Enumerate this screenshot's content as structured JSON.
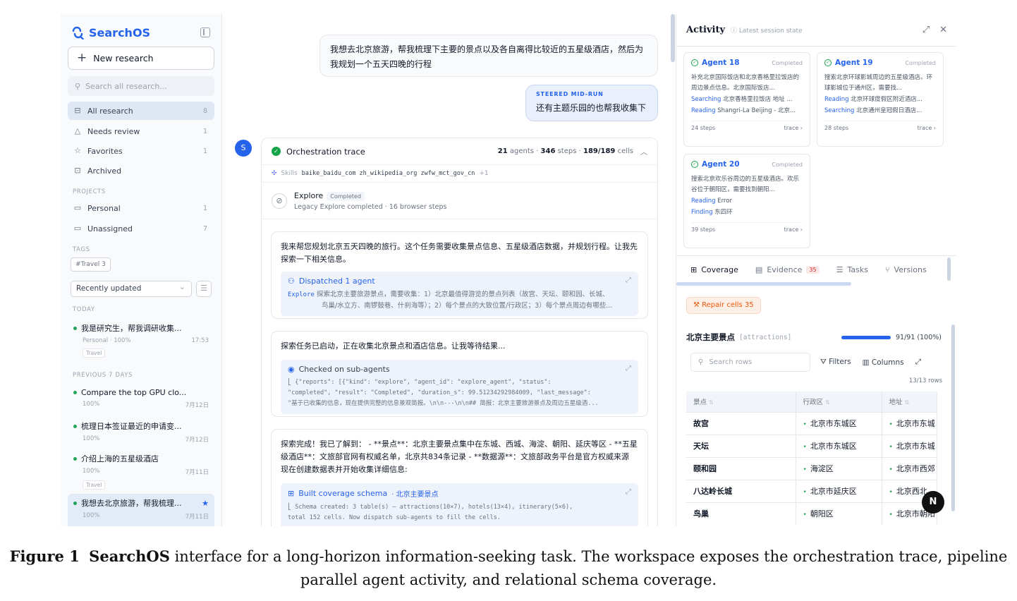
{
  "sidebar": {
    "brand": "SearchOS",
    "new_research": "New research",
    "search_placeholder": "Search all research...",
    "nav": [
      {
        "label": "All research",
        "count": "8"
      },
      {
        "label": "Needs review",
        "count": "1"
      },
      {
        "label": "Favorites",
        "count": "1"
      },
      {
        "label": "Archived",
        "count": ""
      }
    ],
    "projects_head": "PROJECTS",
    "projects": [
      {
        "label": "Personal",
        "count": "1"
      },
      {
        "label": "Unassigned",
        "count": "7"
      }
    ],
    "tags_head": "TAGS",
    "tag": "#Travel 3",
    "sort": "Recently updated",
    "today_head": "TODAY",
    "prev_head": "PREVIOUS 7 DAYS",
    "items": [
      {
        "title": "我是研究生，帮我调研收集...",
        "meta": "Personal · 100%",
        "date": "17:53",
        "tag": "Travel"
      },
      {
        "title": "Compare the top GPU clo...",
        "meta": "100%",
        "date": "7月12日",
        "tag": ""
      },
      {
        "title": "梳理日本签证最近的申请变...",
        "meta": "100%",
        "date": "7月12日",
        "tag": ""
      },
      {
        "title": "介绍上海的五星级酒店",
        "meta": "100%",
        "date": "7月11日",
        "tag": "Travel"
      },
      {
        "title": "我想去北京旅游，帮我梳理...",
        "meta": "100%",
        "date": "7月11日",
        "tag": ""
      }
    ]
  },
  "chat": {
    "user_message": "我想去北京旅游，帮我梳理下主要的景点以及各自离得比较近的五星级酒店，然后为我规划一个五天四晚的行程",
    "steer_label": "STEERED MID-RUN",
    "steer_text": "还有主题乐园的也帮我收集下",
    "avatar": "S",
    "trace": {
      "title": "Orchestration trace",
      "agents": "21",
      "agents_label": "agents ·",
      "steps": "346",
      "steps_label": "steps ·",
      "cells": "189/189",
      "cells_label": "cells",
      "skills_label": "Skills",
      "skills": "baike_baidu_com zh_wikipedia_org zwfw_mct_gov_cn",
      "skills_more": "+1",
      "explore_title": "Explore",
      "explore_badge": "Completed",
      "explore_sub": "Legacy Explore completed · 16 browser steps"
    },
    "messages": [
      {
        "text": "我来帮您规划北京五天四晚的旅行。这个任务需要收集景点信息、五星级酒店数据，并规划行程。让我先探索一下相关信息。",
        "sub_title": "Dispatched 1 agent",
        "sub_key": "Explore",
        "sub_body": "探索北京主要旅游景点，需要收集：1）北京最值得游览的景点列表（故宫、天坛、颐和园、长城、",
        "sub_body2": "鸟巢/水立方、南锣鼓巷、什刹海等）；2）每个景点的大致位置/行政区；3）每个景点周边有哪些..."
      },
      {
        "text": "探索任务已启动，正在收集北京景点和酒店信息。让我等待结果...",
        "sub_title": "Checked on sub-agents",
        "sub_body": "⎣ {\"reports\": [{\"kind\": \"explore\", \"agent_id\": \"explore_agent\", \"status\":",
        "sub_body2": "\"completed\", \"result\": \"Completed\", \"duration_s\": 99.51234292984009, \"last_message\":",
        "sub_body3": "\"基于已收集的信息，现在提供完整的信息景观简报。\\n\\n---\\n\\n## 简报：北京主要旅游景点及周边五星级酒..."
      },
      {
        "text": "探索完成！我已了解到： - **景点**：北京主要景点集中在东城、西城、海淀、朝阳、延庆等区 - **五星级酒店**：文旅部官网有权威名单，北京共834条记录 - **数据源**：文旅部政务平台是官方权威来源 现在创建数据表并开始收集详细信息:",
        "sub_title": "Built coverage schema",
        "sub_title_suffix": "· 北京主要景点",
        "sub_body": "⎣ Schema created: 3 table(s) — attractions(10×7), hotels(13×4), itinerary(5×6),",
        "sub_body2": "total 152 cells. Now dispatch sub-agents to fill the cells."
      }
    ]
  },
  "activity": {
    "title": "Activity",
    "subtitle": "Latest session state",
    "agents": [
      {
        "name": "Agent 18",
        "status": "Completed",
        "desc": "补充北京国际饭店和北京香格里拉饭店的周边景点信息。北京国际饭店...",
        "l1_verb": "Searching",
        "l1": "北京香格里拉饭店 地址 ...",
        "l2_verb": "Reading",
        "l2": "Shangri-La Beijing - 北京...",
        "steps": "24 steps",
        "trace": "trace ›"
      },
      {
        "name": "Agent 19",
        "status": "Completed",
        "desc": "搜索北京环球影城周边的五星级酒店。环球影城位于通州区，需要找...",
        "l1_verb": "Reading",
        "l1": "北京环球度假区附近酒店...",
        "l2_verb": "Searching",
        "l2": "北京通州皇冠假日酒店...",
        "steps": "28 steps",
        "trace": "trace ›"
      },
      {
        "name": "Agent 20",
        "status": "Completed",
        "desc": "搜索北京欢乐谷周边的五星级酒店。欢乐谷位于朝阳区，需要找到朝阳...",
        "l1_verb": "Reading",
        "l1": "Error",
        "l2_verb": "Finding",
        "l2": "东四环",
        "steps": "39 steps",
        "trace": "trace ›"
      }
    ],
    "tabs": [
      {
        "label": "Coverage",
        "count": ""
      },
      {
        "label": "Evidence",
        "count": "35"
      },
      {
        "label": "Tasks",
        "count": ""
      },
      {
        "label": "Versions",
        "count": ""
      }
    ],
    "repair": "Repair cells 35",
    "schema_name": "北京主要景点",
    "schema_key": "[attractions]",
    "coverage_progress": 1.0,
    "coverage_text": "91/91 (100%)",
    "search_placeholder": "Search rows",
    "filters": "Filters",
    "columns": "Columns",
    "row_count": "13/13 rows",
    "table": {
      "headers": [
        "景点",
        "行政区",
        "地址"
      ],
      "rows": [
        [
          "故宫",
          "北京市东城区",
          "北京市东城"
        ],
        [
          "天坛",
          "北京市东城区",
          "北京市东城"
        ],
        [
          "颐和园",
          "海淀区",
          "北京市西郊"
        ],
        [
          "八达岭长城",
          "北京市延庆区",
          "北京西北"
        ],
        [
          "鸟巢",
          "朝阳区",
          "北京市朝阳"
        ]
      ]
    },
    "fab": "N"
  },
  "caption": {
    "label": "Figure 1",
    "bold": "SearchOS",
    "text": "interface for a long-horizon information-seeking task. The workspace exposes the orchestration trace, pipeline",
    "line2": "parallel agent activity, and relational schema coverage."
  },
  "colors": {
    "accent": "#2563eb",
    "success": "#16a34a",
    "warning": "#ea580c"
  }
}
